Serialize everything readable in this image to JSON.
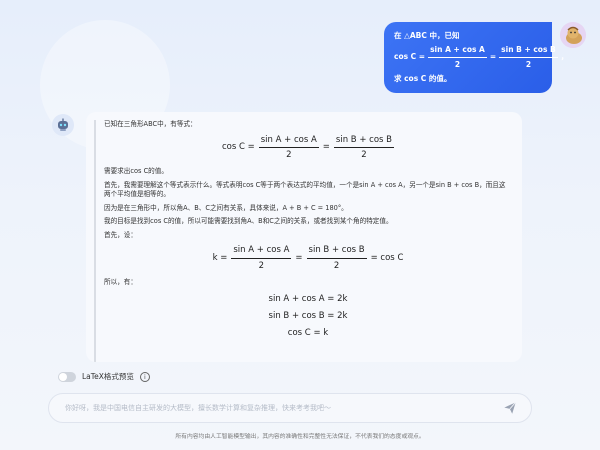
{
  "user_message": {
    "line1": "在 △ABC 中，已知",
    "cos_c": "cos C =",
    "frac1_num": "sin A + cos A",
    "frac1_den": "2",
    "eq": "=",
    "frac2_num": "sin B + cos B",
    "frac2_den": "2",
    "comma": "，",
    "line3": "求 cos C 的值。"
  },
  "answer": {
    "intro": "已知在三角形ABC中，有等式：",
    "eq1_lhs": "cos C =",
    "eq1_n1": "sin A + cos A",
    "eq1_d1": "2",
    "eq1_eq": "=",
    "eq1_n2": "sin B + cos B",
    "eq1_d2": "2",
    "p1": "需要求出cos C的值。",
    "p2": "首先，我需要理解这个等式表示什么。等式表明cos C等于两个表达式的平均值，一个是sin A + cos A，另一个是sin B + cos B，而且这两个平均值是相等的。",
    "p3": "因为是在三角形中，所以角A、B、C之间有关系，具体来说，A + B + C = 180°。",
    "p4": "我的目标是找到cos C的值，所以可能需要找到角A、B和C之间的关系，或者找到某个角的特定值。",
    "p5": "首先，设：",
    "eq2_lhs": "k =",
    "eq2_n1": "sin A + cos A",
    "eq2_d1": "2",
    "eq2_eq1": "=",
    "eq2_n2": "sin B + cos B",
    "eq2_d2": "2",
    "eq2_rhs": "= cos C",
    "p6": "所以，有：",
    "eq3": "sin A + cos A = 2k",
    "eq4": "sin B + cos B = 2k",
    "eq5": "cos C = k"
  },
  "latex_toggle": {
    "label": "LaTeX格式预览",
    "on": false
  },
  "input": {
    "placeholder": "你好呀，我是中国电信自主研发的大模型，擅长数学计算和复杂推理，快来考考我吧～"
  },
  "footer": "所有内容均由人工智能模型输出，其内容的准确性和完整性无法保证，不代表我们的态度或观点。",
  "colors": {
    "accent": "#2f64ef",
    "card_bg": "#f7f9fd"
  },
  "icons": [
    "user-avatar-icon",
    "bot-avatar-icon",
    "info-icon",
    "send-icon"
  ]
}
